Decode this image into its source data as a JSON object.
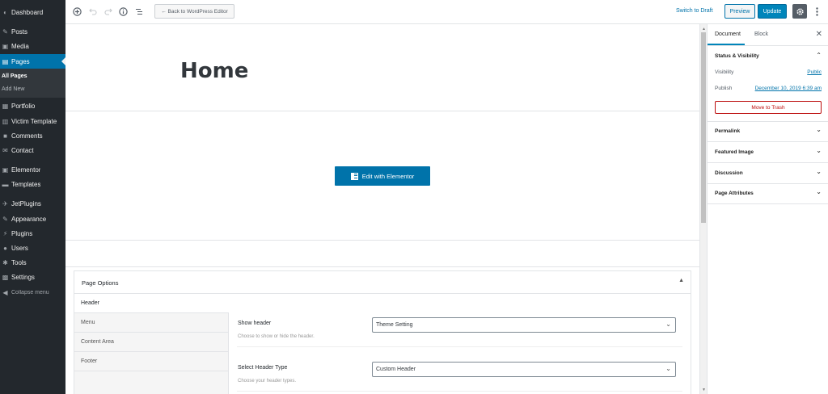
{
  "admin_menu": {
    "items": [
      {
        "label": "Dashboard",
        "icon": "dashboard-icon",
        "glyph": "◐"
      },
      {
        "label": "Posts",
        "icon": "pin-icon",
        "glyph": "✎"
      },
      {
        "label": "Media",
        "icon": "media-icon",
        "glyph": "▣"
      },
      {
        "label": "Pages",
        "icon": "pages-icon",
        "glyph": "▤"
      },
      {
        "label": "Portfolio",
        "icon": "portfolio-icon",
        "glyph": "▦"
      },
      {
        "label": "Victim Template",
        "icon": "template-icon",
        "glyph": "▥"
      },
      {
        "label": "Comments",
        "icon": "comments-icon",
        "glyph": "■"
      },
      {
        "label": "Contact",
        "icon": "mail-icon",
        "glyph": "✉"
      },
      {
        "label": "Elementor",
        "icon": "elementor-icon",
        "glyph": "▣"
      },
      {
        "label": "Templates",
        "icon": "folder-icon",
        "glyph": "▬"
      },
      {
        "label": "JetPlugins",
        "icon": "jetplugins-icon",
        "glyph": "✈"
      },
      {
        "label": "Appearance",
        "icon": "brush-icon",
        "glyph": "✎"
      },
      {
        "label": "Plugins",
        "icon": "plugin-icon",
        "glyph": "⚡"
      },
      {
        "label": "Users",
        "icon": "user-icon",
        "glyph": "●"
      },
      {
        "label": "Tools",
        "icon": "wrench-icon",
        "glyph": "✱"
      },
      {
        "label": "Settings",
        "icon": "settings-icon",
        "glyph": "▩"
      }
    ],
    "submenu": [
      "All Pages",
      "Add New"
    ],
    "collapse": {
      "label": "Collapse menu",
      "glyph": "◀"
    }
  },
  "toolbar": {
    "back_label": "← Back to WordPress Editor",
    "switch_draft_label": "Switch to Draft",
    "preview_label": "Preview",
    "update_label": "Update"
  },
  "post": {
    "title": "Home",
    "elementor_button_label": "Edit with Elementor"
  },
  "page_options": {
    "title": "Page Options",
    "tabs": [
      "Header",
      "Menu",
      "Content Area",
      "Footer"
    ],
    "options": [
      {
        "label": "Show header",
        "description": "Choose to show or hide the header.",
        "value": "Theme Setting"
      },
      {
        "label": "Select Header Type",
        "description": "Choose your header types.",
        "value": "Custom Header"
      }
    ]
  },
  "settings_sidebar": {
    "tabs": [
      "Document",
      "Block"
    ],
    "status_panel_title": "Status & Visibility",
    "visibility_label": "Visibility",
    "visibility_value": "Public",
    "publish_label": "Publish",
    "publish_value": "December 10, 2019 6:39 am",
    "trash_label": "Move to Trash",
    "panels": [
      "Permalink",
      "Featured Image",
      "Discussion",
      "Page Attributes"
    ]
  },
  "colors": {
    "admin_bg": "#23282d",
    "accent": "#0073aa",
    "danger": "#bc0b0b"
  }
}
